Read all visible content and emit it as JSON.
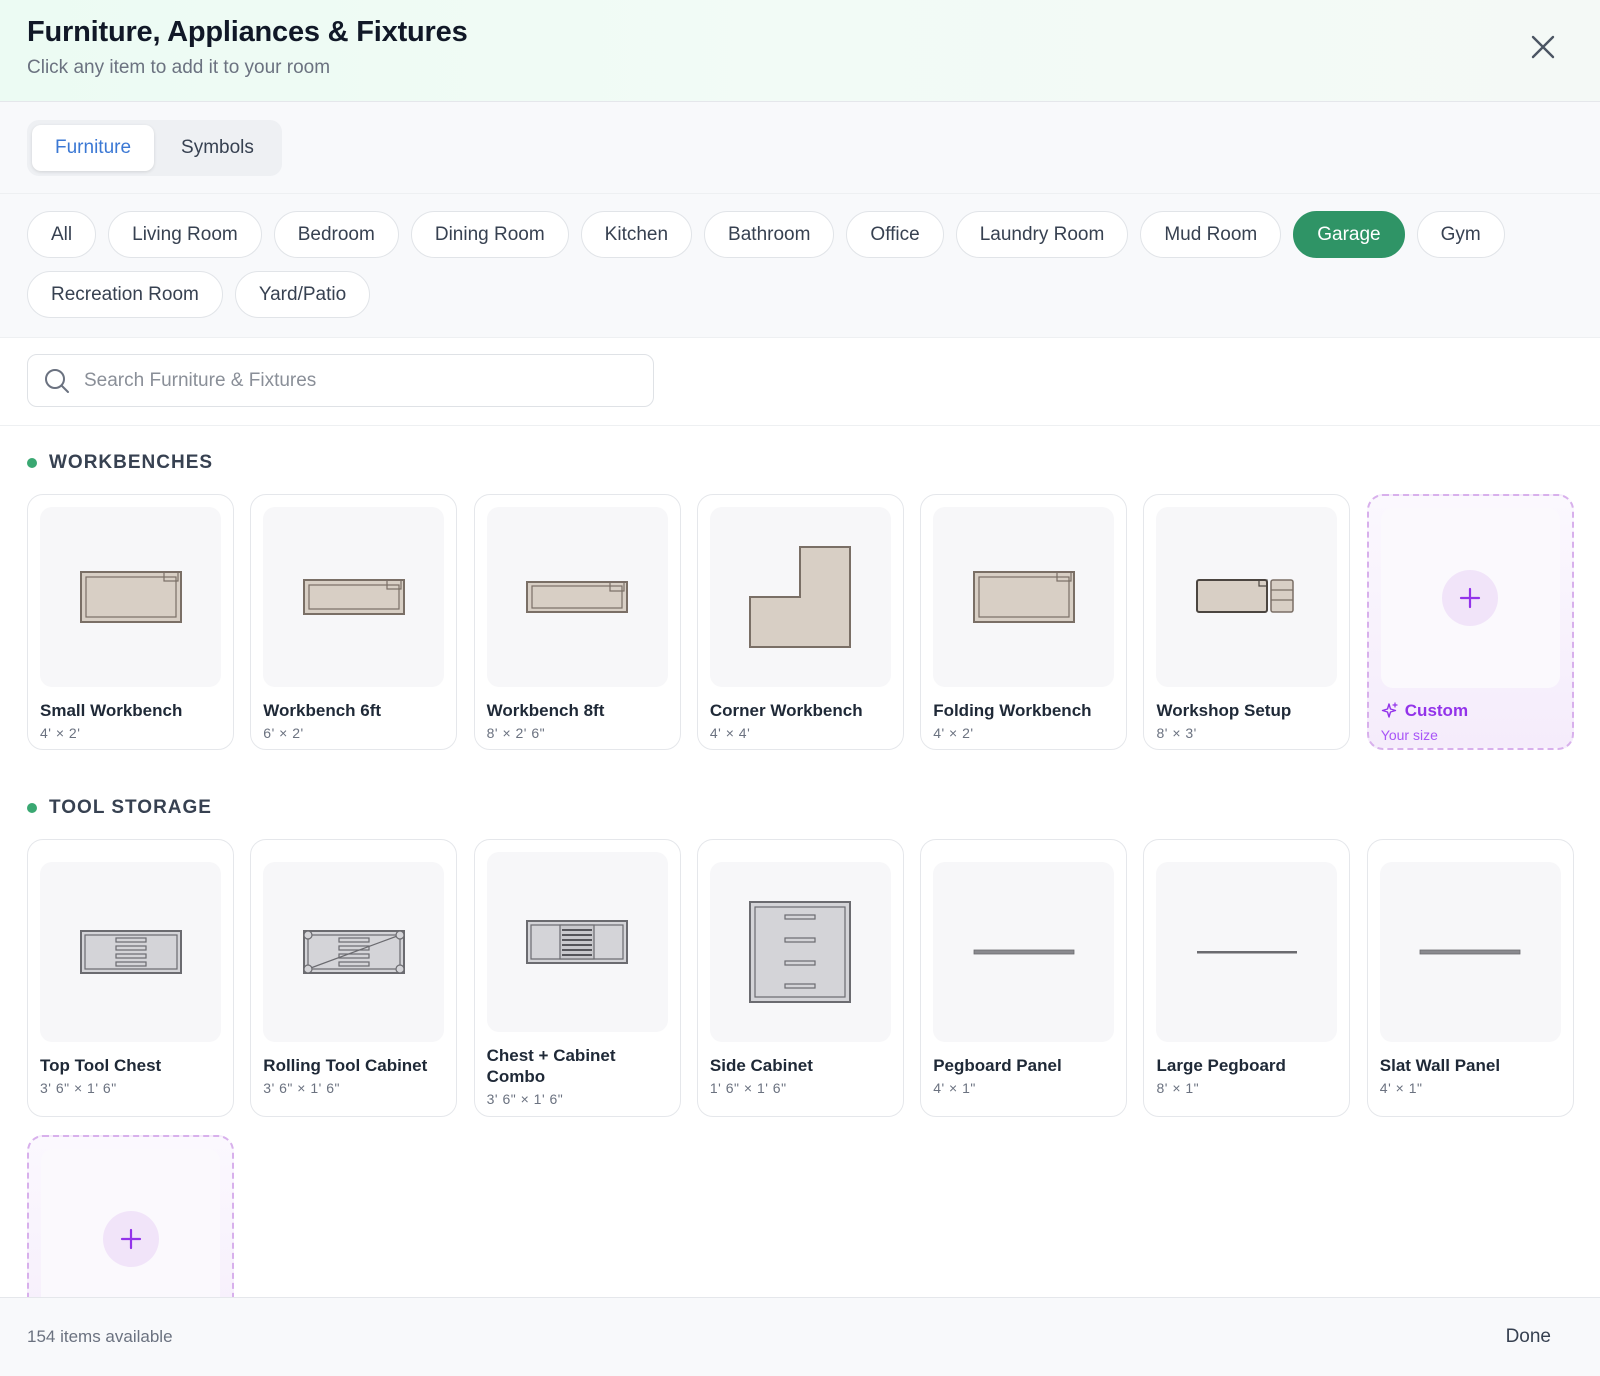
{
  "header": {
    "title": "Furniture, Appliances & Fixtures",
    "subtitle": "Click any item to add it to your room",
    "close_icon": "close-icon"
  },
  "tabs": [
    {
      "label": "Furniture",
      "active": true
    },
    {
      "label": "Symbols",
      "active": false
    }
  ],
  "categories": [
    {
      "label": "All"
    },
    {
      "label": "Living Room"
    },
    {
      "label": "Bedroom"
    },
    {
      "label": "Dining Room"
    },
    {
      "label": "Kitchen"
    },
    {
      "label": "Bathroom"
    },
    {
      "label": "Office"
    },
    {
      "label": "Laundry Room"
    },
    {
      "label": "Mud Room"
    },
    {
      "label": "Garage",
      "active": true
    },
    {
      "label": "Gym"
    },
    {
      "label": "Recreation Room"
    },
    {
      "label": "Yard/Patio"
    }
  ],
  "search": {
    "placeholder": "Search Furniture & Fixtures",
    "value": ""
  },
  "sections": [
    {
      "title": "WORKBENCHES",
      "items": [
        {
          "name": "Small Workbench",
          "dims": "4' × 2'",
          "icon": "small-workbench-icon"
        },
        {
          "name": "Workbench 6ft",
          "dims": "6' × 2'",
          "icon": "workbench-6ft-icon"
        },
        {
          "name": "Workbench 8ft",
          "dims": "8' × 2' 6\"",
          "icon": "workbench-8ft-icon"
        },
        {
          "name": "Corner Workbench",
          "dims": "4' × 4'",
          "icon": "corner-workbench-icon"
        },
        {
          "name": "Folding Workbench",
          "dims": "4' × 2'",
          "icon": "folding-workbench-icon"
        },
        {
          "name": "Workshop Setup",
          "dims": "8' × 3'",
          "icon": "workshop-setup-icon"
        }
      ],
      "custom": {
        "name": "Custom",
        "sub": "Your size"
      }
    },
    {
      "title": "TOOL STORAGE",
      "items": [
        {
          "name": "Top Tool Chest",
          "dims": "3' 6\" × 1' 6\"",
          "icon": "top-tool-chest-icon"
        },
        {
          "name": "Rolling Tool Cabinet",
          "dims": "3' 6\" × 1' 6\"",
          "icon": "rolling-tool-cabinet-icon"
        },
        {
          "name": "Chest + Cabinet Combo",
          "dims": "3' 6\" × 1' 6\"",
          "icon": "chest-cabinet-combo-icon"
        },
        {
          "name": "Side Cabinet",
          "dims": "1' 6\" × 1' 6\"",
          "icon": "side-cabinet-icon"
        },
        {
          "name": "Pegboard Panel",
          "dims": "4' × 1\"",
          "icon": "pegboard-panel-icon"
        },
        {
          "name": "Large Pegboard",
          "dims": "8' × 1\"",
          "icon": "large-pegboard-icon"
        },
        {
          "name": "Slat Wall Panel",
          "dims": "4' × 1\"",
          "icon": "slat-wall-panel-icon"
        }
      ]
    }
  ],
  "footer": {
    "count": "154 items available",
    "done_label": "Done"
  },
  "colors": {
    "accent_green": "#2f9466",
    "tab_active": "#3b78d4",
    "custom_purple": "#9333ea"
  }
}
